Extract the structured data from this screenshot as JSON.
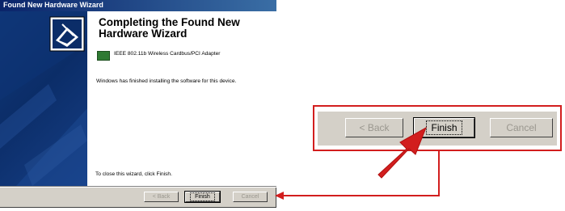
{
  "window": {
    "title": "Found New Hardware Wizard",
    "heading": "Completing the Found New Hardware Wizard",
    "device_name": "IEEE 802.11b Wireless Cardbus/PCI Adapter",
    "finished_message": "Windows has finished installing the software for this device.",
    "close_message": "To close this wizard, click Finish."
  },
  "buttons": {
    "back_label": "< Back",
    "finish_label": "Finish",
    "cancel_label": "Cancel"
  },
  "zoom": {
    "back_label": "< Back",
    "finish_label": "Finish",
    "cancel_label": "Cancel"
  },
  "colors": {
    "title_bar": "#0a246a",
    "side_panel": "#0b2d68",
    "highlight_red": "#d21e1e",
    "dialog_gray": "#d4d0c8"
  },
  "icons": {
    "wizard_icon": "hardware-wizard-icon",
    "device_icon": "network-card-icon",
    "pointer": "red-pointer-arrow"
  }
}
